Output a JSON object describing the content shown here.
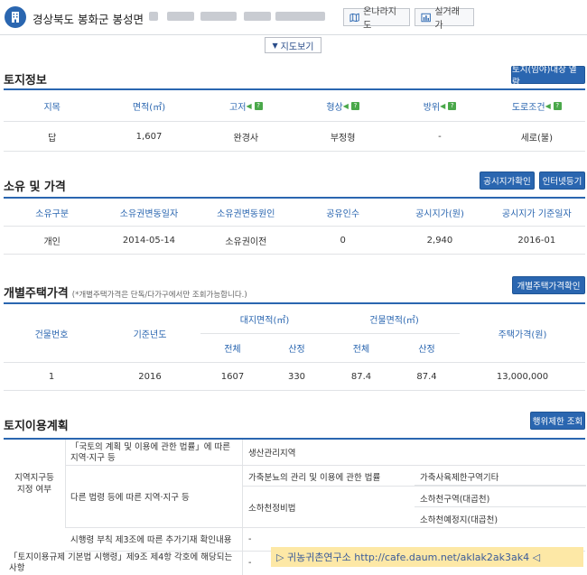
{
  "header": {
    "address": "경상북도 봉화군 봉성면",
    "online_map_label": "온나라지도",
    "real_trade_label": "실거래가"
  },
  "map_toggle": {
    "label": "지도보기"
  },
  "land_info": {
    "title": "토지정보",
    "ledger_button": "토지(임야)대장 열람",
    "columns": [
      "지목",
      "면적(㎡)",
      "고저",
      "형상",
      "방위",
      "도로조건"
    ],
    "values": [
      "답",
      "1,607",
      "완경사",
      "부정형",
      "-",
      "세로(불)"
    ]
  },
  "ownership": {
    "title": "소유 및 가격",
    "official_price_button": "공시지가확인",
    "internet_register_button": "인터넷등기",
    "columns": [
      "소유구분",
      "소유권변동일자",
      "소유권변동원인",
      "공유인수",
      "공시지가(원)",
      "공시지가 기준일자"
    ],
    "values": [
      "개인",
      "2014-05-14",
      "소유권이전",
      "0",
      "2,940",
      "2016-01"
    ]
  },
  "house_price": {
    "title": "개별주택가격",
    "note": "(*개별주택가격은 단독/다가구에서만 조회가능합니다.)",
    "check_button": "개별주택가격확인",
    "col_building_no": "건물번호",
    "col_base_year": "기준년도",
    "col_land_area": "대지면적(㎡)",
    "col_building_area": "건물면적(㎡)",
    "col_house_price": "주택가격(원)",
    "sub_total": "전체",
    "sub_calc": "산정",
    "row": {
      "building_no": "1",
      "base_year": "2016",
      "land_total": "1607",
      "land_calc": "330",
      "bldg_total": "87.4",
      "bldg_calc": "87.4",
      "price": "13,000,000"
    }
  },
  "land_use": {
    "title": "토지이용계획",
    "restriction_button": "행위제한 조회",
    "left_label_1": "지역지구등",
    "left_label_2": "지정 여부",
    "row1_label": "「국토의 계획 및 이용에 관한 법률」에 따른 지역·지구 등",
    "row1_value": "생산관리지역",
    "row2_label": "다른 법령 등에 따른 지역·지구 등",
    "row2_v1": "가축분뇨의 관리 및 이용에 관한 법률",
    "row2_v2": "가축사육제한구역기타",
    "row2_v3": "소하천정비법",
    "row2_v4": "소하천구역(대곱천)",
    "row2_v5": "소하천예정지(대곱천)",
    "row3_label": "시행령 부칙 제3조에 따른 추가기재 확인내용",
    "row3_value": "-",
    "row4_label": "「토지이용규제 기본법 시행령」제9조 제4항 각호에 해당되는 사항",
    "row4_value": "-"
  },
  "watermark": "▷ 귀농귀촌연구소 http://cafe.daum.net/aklak2ak3ak4 ◁"
}
